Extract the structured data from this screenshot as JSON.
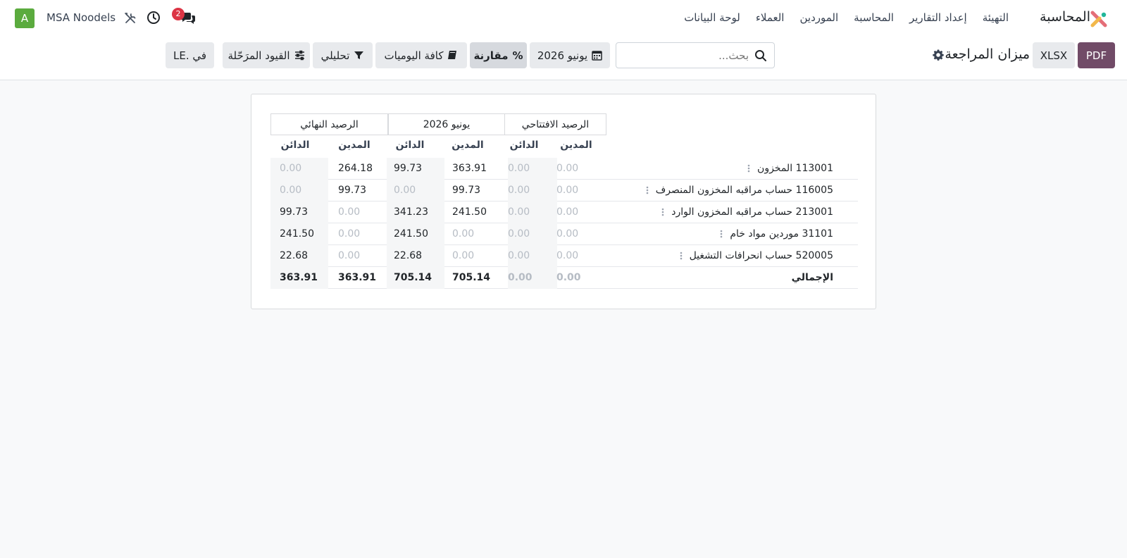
{
  "nav": {
    "brand": "المحاسبة",
    "menu": [
      "لوحة البيانات",
      "العملاء",
      "الموردين",
      "المحاسبة",
      "إعداد التقارير",
      "التهيئة"
    ],
    "company": "MSA Noodels",
    "avatar": "A",
    "chat_count": "2"
  },
  "control": {
    "pdf": "PDF",
    "xlsx": "XLSX",
    "title": "ميزان المراجعة",
    "search_placeholder": "بحث...",
    "date": "يونيو 2026",
    "comparison": "مقارنة",
    "journals": "كافة اليوميات",
    "analytic": "تحليلي",
    "posted": "القيود المرَحّلة",
    "currency": "في .LE"
  },
  "report": {
    "groups": [
      "الرصيد الافتتاحي",
      "يونيو 2026",
      "الرصيد النهائي"
    ],
    "debit": "المدين",
    "credit": "الدائن",
    "rows": [
      {
        "label": "113001 المخزون",
        "v": [
          "0.00",
          "0.00",
          "363.91",
          "99.73",
          "264.18",
          "0.00"
        ]
      },
      {
        "label": "116005 حساب مراقبه المخزون المنصرف",
        "v": [
          "0.00",
          "0.00",
          "99.73",
          "0.00",
          "99.73",
          "0.00"
        ]
      },
      {
        "label": "213001 حساب مراقبه المخزون الوارد",
        "v": [
          "0.00",
          "0.00",
          "241.50",
          "341.23",
          "0.00",
          "99.73"
        ]
      },
      {
        "label": "31101 موردين مواد خام",
        "v": [
          "0.00",
          "0.00",
          "0.00",
          "241.50",
          "0.00",
          "241.50"
        ]
      },
      {
        "label": "520005 حساب انحرافات التشغيل",
        "v": [
          "0.00",
          "0.00",
          "0.00",
          "22.68",
          "0.00",
          "22.68"
        ]
      }
    ],
    "total": {
      "label": "الإجمالي",
      "v": [
        "0.00",
        "0.00",
        "705.14",
        "705.14",
        "363.91",
        "363.91"
      ]
    }
  },
  "colors": {
    "primary": "#714b67",
    "avatar": "#5bab3e",
    "badge": "#dc3545"
  },
  "icons": [
    "app-logo-icon",
    "tools-icon",
    "clock-icon",
    "chat-icon",
    "gear-icon",
    "search-icon",
    "calendar-icon",
    "percent-icon",
    "book-icon",
    "filter-icon",
    "sliders-icon",
    "row-menu-icon"
  ]
}
